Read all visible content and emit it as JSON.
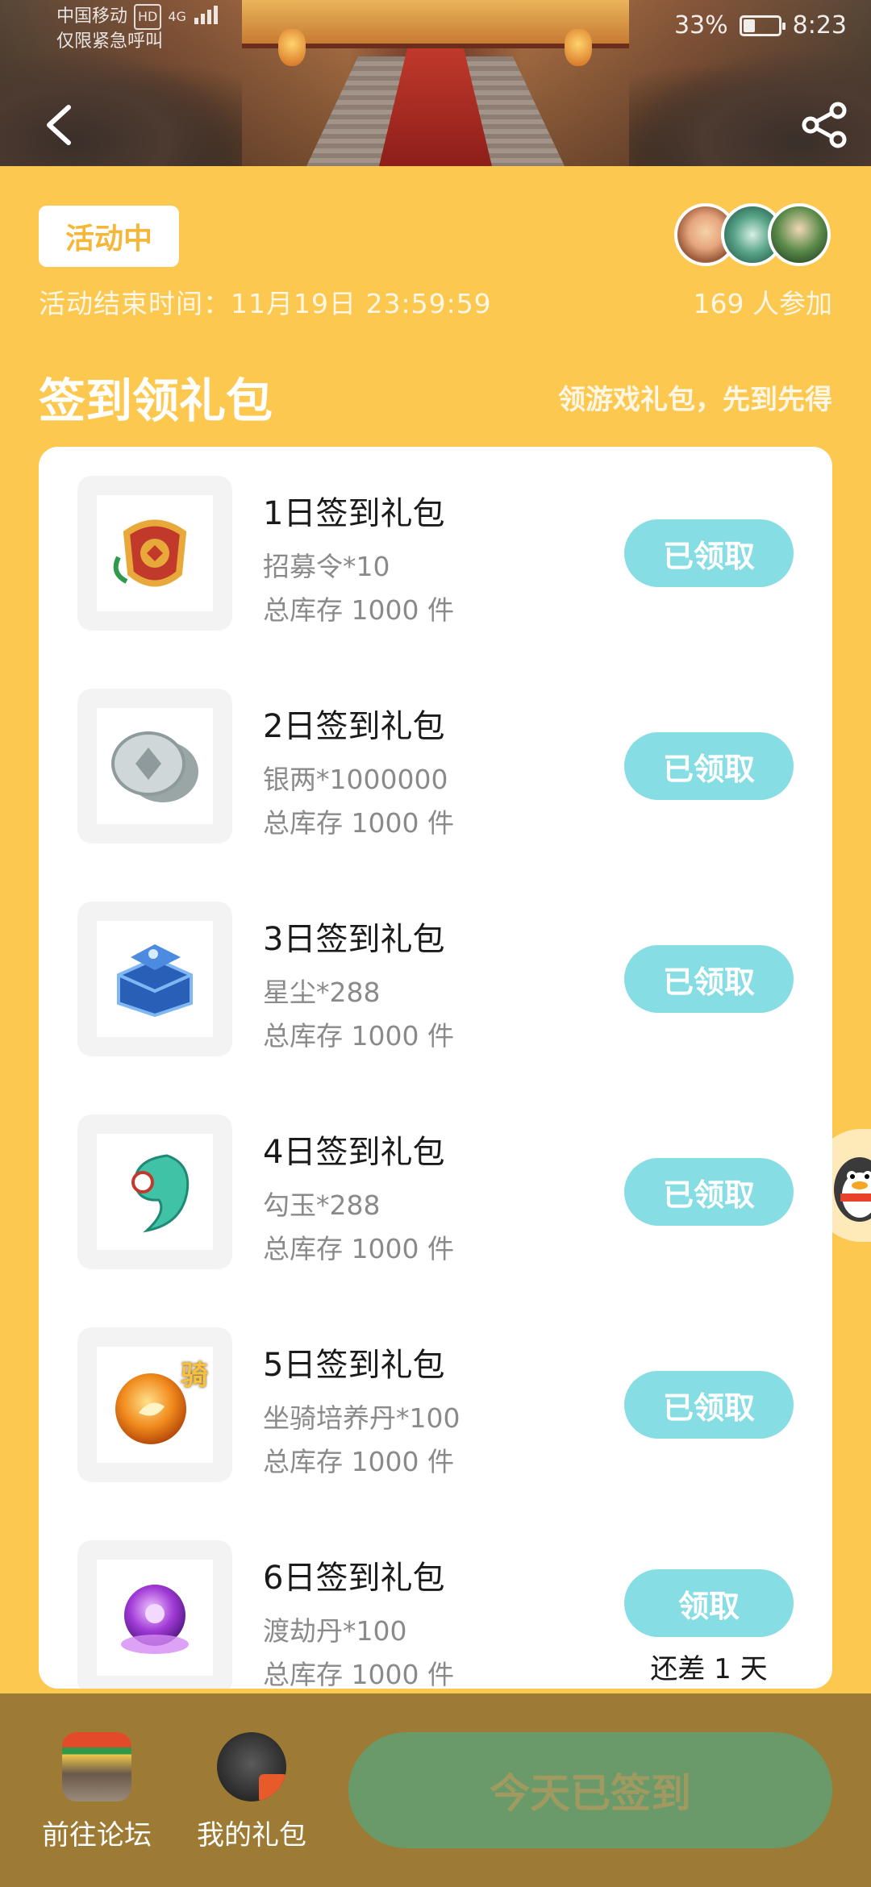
{
  "status_bar": {
    "carrier": "中国移动",
    "carrier_badge": "HD",
    "network": "4G",
    "emergency": "仅限紧急呼叫",
    "battery": "33%",
    "time": "8:23"
  },
  "header": {
    "back_icon": "chevron-left-icon",
    "share_icon": "share-icon"
  },
  "activity": {
    "status": "活动中",
    "end_time": "活动结束时间：11月19日 23:59:59",
    "participants": "169 人参加"
  },
  "section": {
    "title": "签到领礼包",
    "subtitle": "领游戏礼包，先到先得"
  },
  "gifts": [
    {
      "title": "1日签到礼包",
      "desc": "招募令*10",
      "stock": "总库存 1000 件",
      "button": "已领取",
      "icon": "token-icon"
    },
    {
      "title": "2日签到礼包",
      "desc": "银两*1000000",
      "stock": "总库存 1000 件",
      "button": "已领取",
      "icon": "silver-coin-icon"
    },
    {
      "title": "3日签到礼包",
      "desc": "星尘*288",
      "stock": "总库存 1000 件",
      "button": "已领取",
      "icon": "stardust-chest-icon"
    },
    {
      "title": "4日签到礼包",
      "desc": "勾玉*288",
      "stock": "总库存 1000 件",
      "button": "已领取",
      "icon": "jade-icon"
    },
    {
      "title": "5日签到礼包",
      "desc": "坐骑培养丹*100",
      "stock": "总库存 1000 件",
      "button": "已领取",
      "icon": "mount-pill-icon",
      "badge": "骑"
    },
    {
      "title": "6日签到礼包",
      "desc": "渡劫丹*100",
      "stock": "总库存 1000 件",
      "button": "领取",
      "icon": "purple-orb-icon",
      "remaining": "还差 1 天"
    }
  ],
  "bottom": {
    "forum": "前往论坛",
    "my_gifts": "我的礼包",
    "signed": "今天已签到"
  },
  "colors": {
    "background": "#FDC84F",
    "claim_button": "#86DDE4",
    "bottom_bar": "#9E7B35",
    "signed_button": "#6A9A6A"
  }
}
